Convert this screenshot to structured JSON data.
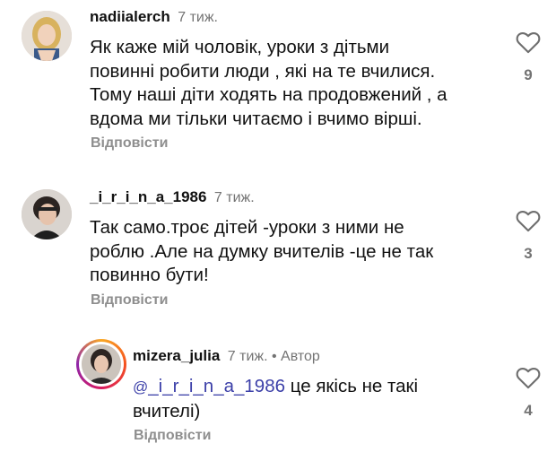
{
  "comments": [
    {
      "username": "nadiialerch",
      "time": "7 тиж.",
      "lines": [
        "Як каже мій чоловік, уроки з дітьми",
        "повинні робити люди , які на те вчилися.",
        "Тому наші діти ходять на продовжений , а",
        "вдома ми тільки читаємо і вчимо вірші."
      ],
      "reply_label": "Відповісти",
      "likes": "9"
    },
    {
      "username": "_i_r_i_n_a_1986",
      "time": "7 тиж.",
      "lines": [
        "Так само.троє дітей -уроки з ними не",
        "роблю .Але на думку вчителів -це не так",
        "повинно бути!"
      ],
      "reply_label": "Відповісти",
      "likes": "3"
    },
    {
      "username": "mizera_julia",
      "time": "7 тиж.",
      "author_badge": "• Автор",
      "mention_icon": "@",
      "mention": "_i_r_i_n_a_1986",
      "line1_rest": " це якісь не такі",
      "line2": "вчителі)",
      "reply_label": "Відповісти",
      "likes": "4"
    }
  ],
  "colors": {
    "mention": "#3b3fa8",
    "muted": "#737373",
    "reply": "#8e8e8e"
  },
  "icons": {
    "like": "heart-outline-icon",
    "mention": "threads-at-icon"
  }
}
